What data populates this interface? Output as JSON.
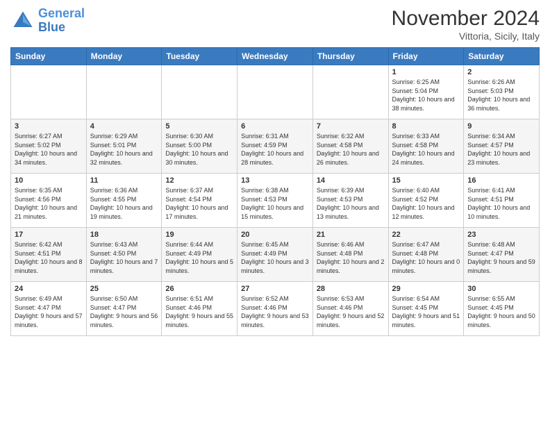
{
  "header": {
    "logo_line1": "General",
    "logo_line2": "Blue",
    "month": "November 2024",
    "location": "Vittoria, Sicily, Italy"
  },
  "weekdays": [
    "Sunday",
    "Monday",
    "Tuesday",
    "Wednesday",
    "Thursday",
    "Friday",
    "Saturday"
  ],
  "weeks": [
    [
      {
        "day": "",
        "info": ""
      },
      {
        "day": "",
        "info": ""
      },
      {
        "day": "",
        "info": ""
      },
      {
        "day": "",
        "info": ""
      },
      {
        "day": "",
        "info": ""
      },
      {
        "day": "1",
        "info": "Sunrise: 6:25 AM\nSunset: 5:04 PM\nDaylight: 10 hours and 38 minutes."
      },
      {
        "day": "2",
        "info": "Sunrise: 6:26 AM\nSunset: 5:03 PM\nDaylight: 10 hours and 36 minutes."
      }
    ],
    [
      {
        "day": "3",
        "info": "Sunrise: 6:27 AM\nSunset: 5:02 PM\nDaylight: 10 hours and 34 minutes."
      },
      {
        "day": "4",
        "info": "Sunrise: 6:29 AM\nSunset: 5:01 PM\nDaylight: 10 hours and 32 minutes."
      },
      {
        "day": "5",
        "info": "Sunrise: 6:30 AM\nSunset: 5:00 PM\nDaylight: 10 hours and 30 minutes."
      },
      {
        "day": "6",
        "info": "Sunrise: 6:31 AM\nSunset: 4:59 PM\nDaylight: 10 hours and 28 minutes."
      },
      {
        "day": "7",
        "info": "Sunrise: 6:32 AM\nSunset: 4:58 PM\nDaylight: 10 hours and 26 minutes."
      },
      {
        "day": "8",
        "info": "Sunrise: 6:33 AM\nSunset: 4:58 PM\nDaylight: 10 hours and 24 minutes."
      },
      {
        "day": "9",
        "info": "Sunrise: 6:34 AM\nSunset: 4:57 PM\nDaylight: 10 hours and 23 minutes."
      }
    ],
    [
      {
        "day": "10",
        "info": "Sunrise: 6:35 AM\nSunset: 4:56 PM\nDaylight: 10 hours and 21 minutes."
      },
      {
        "day": "11",
        "info": "Sunrise: 6:36 AM\nSunset: 4:55 PM\nDaylight: 10 hours and 19 minutes."
      },
      {
        "day": "12",
        "info": "Sunrise: 6:37 AM\nSunset: 4:54 PM\nDaylight: 10 hours and 17 minutes."
      },
      {
        "day": "13",
        "info": "Sunrise: 6:38 AM\nSunset: 4:53 PM\nDaylight: 10 hours and 15 minutes."
      },
      {
        "day": "14",
        "info": "Sunrise: 6:39 AM\nSunset: 4:53 PM\nDaylight: 10 hours and 13 minutes."
      },
      {
        "day": "15",
        "info": "Sunrise: 6:40 AM\nSunset: 4:52 PM\nDaylight: 10 hours and 12 minutes."
      },
      {
        "day": "16",
        "info": "Sunrise: 6:41 AM\nSunset: 4:51 PM\nDaylight: 10 hours and 10 minutes."
      }
    ],
    [
      {
        "day": "17",
        "info": "Sunrise: 6:42 AM\nSunset: 4:51 PM\nDaylight: 10 hours and 8 minutes."
      },
      {
        "day": "18",
        "info": "Sunrise: 6:43 AM\nSunset: 4:50 PM\nDaylight: 10 hours and 7 minutes."
      },
      {
        "day": "19",
        "info": "Sunrise: 6:44 AM\nSunset: 4:49 PM\nDaylight: 10 hours and 5 minutes."
      },
      {
        "day": "20",
        "info": "Sunrise: 6:45 AM\nSunset: 4:49 PM\nDaylight: 10 hours and 3 minutes."
      },
      {
        "day": "21",
        "info": "Sunrise: 6:46 AM\nSunset: 4:48 PM\nDaylight: 10 hours and 2 minutes."
      },
      {
        "day": "22",
        "info": "Sunrise: 6:47 AM\nSunset: 4:48 PM\nDaylight: 10 hours and 0 minutes."
      },
      {
        "day": "23",
        "info": "Sunrise: 6:48 AM\nSunset: 4:47 PM\nDaylight: 9 hours and 59 minutes."
      }
    ],
    [
      {
        "day": "24",
        "info": "Sunrise: 6:49 AM\nSunset: 4:47 PM\nDaylight: 9 hours and 57 minutes."
      },
      {
        "day": "25",
        "info": "Sunrise: 6:50 AM\nSunset: 4:47 PM\nDaylight: 9 hours and 56 minutes."
      },
      {
        "day": "26",
        "info": "Sunrise: 6:51 AM\nSunset: 4:46 PM\nDaylight: 9 hours and 55 minutes."
      },
      {
        "day": "27",
        "info": "Sunrise: 6:52 AM\nSunset: 4:46 PM\nDaylight: 9 hours and 53 minutes."
      },
      {
        "day": "28",
        "info": "Sunrise: 6:53 AM\nSunset: 4:46 PM\nDaylight: 9 hours and 52 minutes."
      },
      {
        "day": "29",
        "info": "Sunrise: 6:54 AM\nSunset: 4:45 PM\nDaylight: 9 hours and 51 minutes."
      },
      {
        "day": "30",
        "info": "Sunrise: 6:55 AM\nSunset: 4:45 PM\nDaylight: 9 hours and 50 minutes."
      }
    ]
  ]
}
